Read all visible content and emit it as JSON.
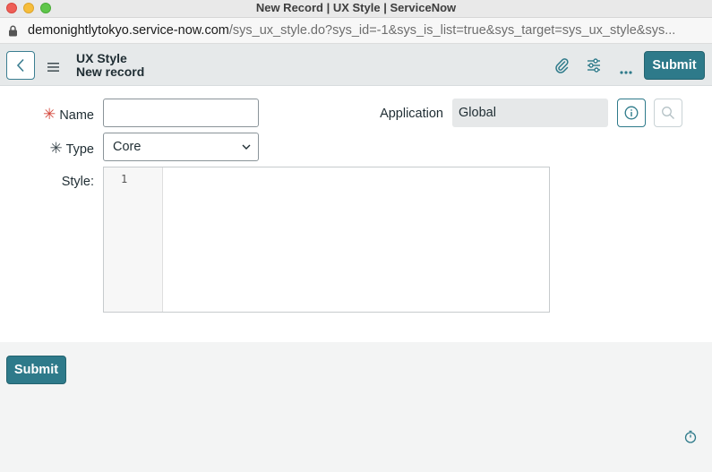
{
  "window": {
    "title": "New Record | UX Style | ServiceNow"
  },
  "browser": {
    "url_host": "demonightlytokyo.service-now.com",
    "url_path": "/sys_ux_style.do?sys_id=-1&sys_is_list=true&sys_target=sys_ux_style&sys..."
  },
  "header": {
    "table_name": "UX Style",
    "record_name": "New record",
    "submit_label": "Submit"
  },
  "form": {
    "name_label": "Name",
    "name_value": "",
    "type_label": "Type",
    "type_value": "Core",
    "application_label": "Application",
    "application_value": "Global",
    "style_label": "Style:",
    "editor_line_number": "1",
    "required_mark": "✳"
  },
  "footer": {
    "submit_label": "Submit"
  },
  "colors": {
    "accent": "#2e7a8a",
    "required": "#d4483c",
    "header_bg": "#e6e9ea"
  }
}
